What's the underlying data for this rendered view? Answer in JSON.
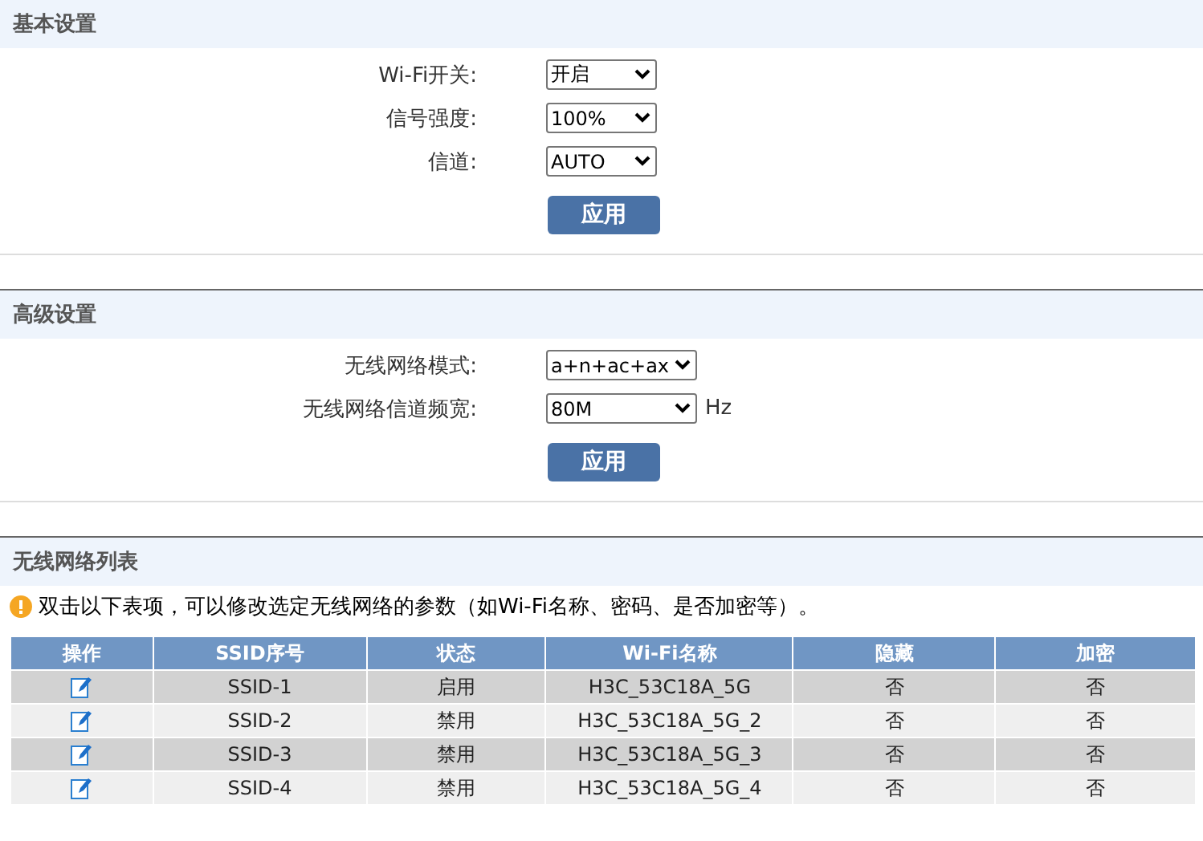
{
  "basic": {
    "title": "基本设置",
    "fields": [
      {
        "label": "Wi-Fi开关:",
        "value": "开启"
      },
      {
        "label": "信号强度:",
        "value": "100%"
      },
      {
        "label": "信道:",
        "value": "AUTO"
      }
    ],
    "button": "应用"
  },
  "advanced": {
    "title": "高级设置",
    "fields": [
      {
        "label": "无线网络模式:",
        "value": "a+n+ac+ax"
      },
      {
        "label": "无线网络信道频宽:",
        "value": "80M",
        "unit": "Hz"
      }
    ],
    "button": "应用"
  },
  "wireless_list": {
    "title": "无线网络列表",
    "notice": "双击以下表项，可以修改选定无线网络的参数（如Wi-Fi名称、密码、是否加密等）。",
    "columns": [
      "操作",
      "SSID序号",
      "状态",
      "Wi-Fi名称",
      "隐藏",
      "加密"
    ],
    "rows": [
      {
        "ssid": "SSID-1",
        "status": "启用",
        "name": "H3C_53C18A_5G",
        "hidden": "否",
        "encrypted": "否"
      },
      {
        "ssid": "SSID-2",
        "status": "禁用",
        "name": "H3C_53C18A_5G_2",
        "hidden": "否",
        "encrypted": "否"
      },
      {
        "ssid": "SSID-3",
        "status": "禁用",
        "name": "H3C_53C18A_5G_3",
        "hidden": "否",
        "encrypted": "否"
      },
      {
        "ssid": "SSID-4",
        "status": "禁用",
        "name": "H3C_53C18A_5G_4",
        "hidden": "否",
        "encrypted": "否"
      }
    ]
  }
}
